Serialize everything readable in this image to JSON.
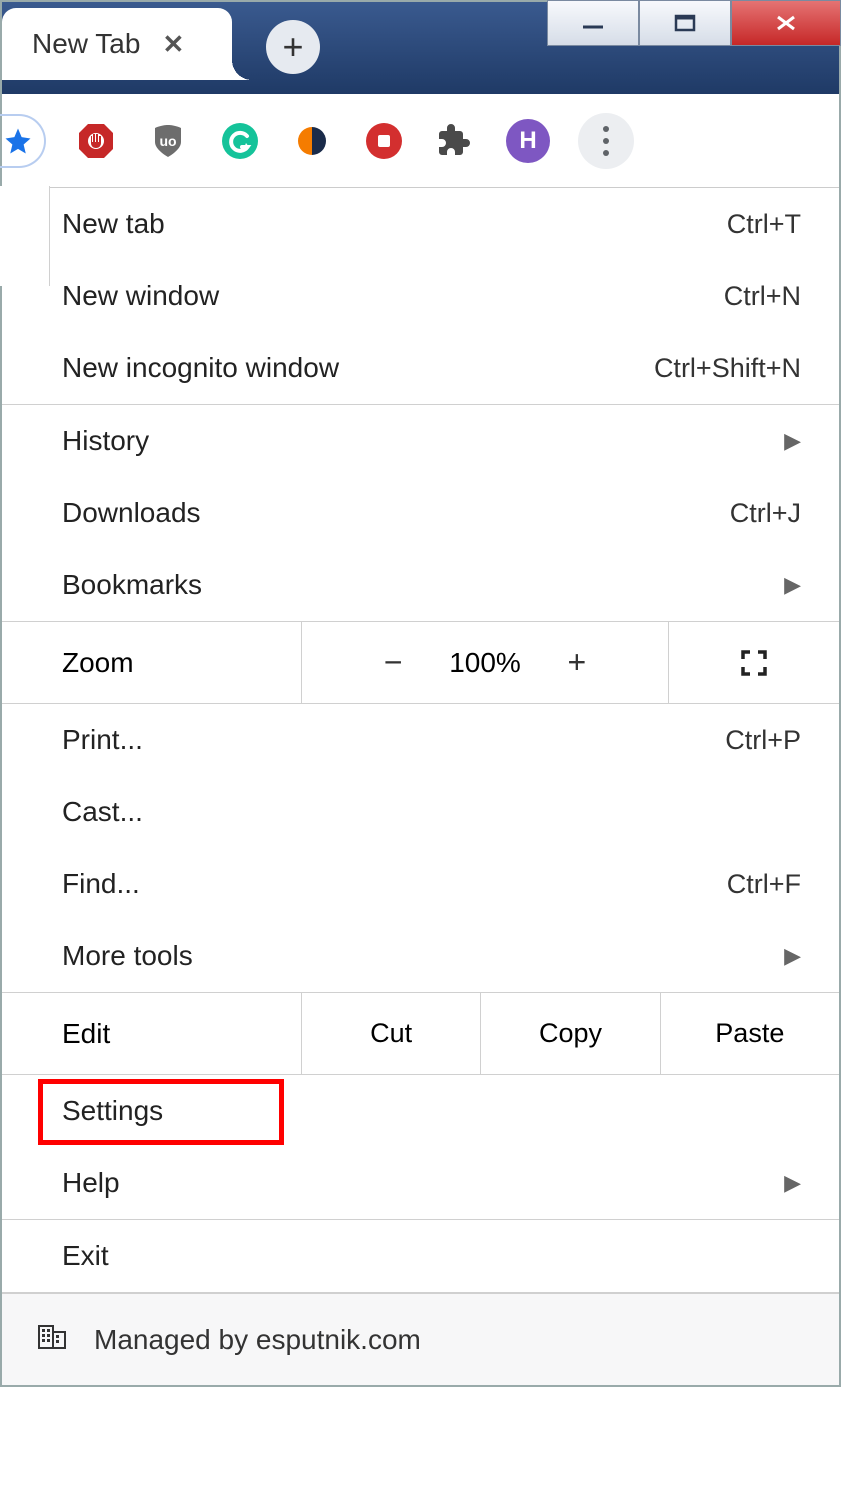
{
  "tab": {
    "title": "New Tab"
  },
  "profile": {
    "letter": "H"
  },
  "zoom": {
    "label": "Zoom",
    "level": "100%"
  },
  "edit": {
    "label": "Edit",
    "cut": "Cut",
    "copy": "Copy",
    "paste": "Paste"
  },
  "footer": {
    "text": "Managed by esputnik.com"
  },
  "menu": {
    "new_tab": {
      "label": "New tab",
      "shortcut": "Ctrl+T"
    },
    "new_window": {
      "label": "New window",
      "shortcut": "Ctrl+N"
    },
    "new_incognito": {
      "label": "New incognito window",
      "shortcut": "Ctrl+Shift+N"
    },
    "history": {
      "label": "History"
    },
    "downloads": {
      "label": "Downloads",
      "shortcut": "Ctrl+J"
    },
    "bookmarks": {
      "label": "Bookmarks"
    },
    "print": {
      "label": "Print...",
      "shortcut": "Ctrl+P"
    },
    "cast": {
      "label": "Cast..."
    },
    "find": {
      "label": "Find...",
      "shortcut": "Ctrl+F"
    },
    "more_tools": {
      "label": "More tools"
    },
    "settings": {
      "label": "Settings"
    },
    "help": {
      "label": "Help"
    },
    "exit": {
      "label": "Exit"
    }
  }
}
